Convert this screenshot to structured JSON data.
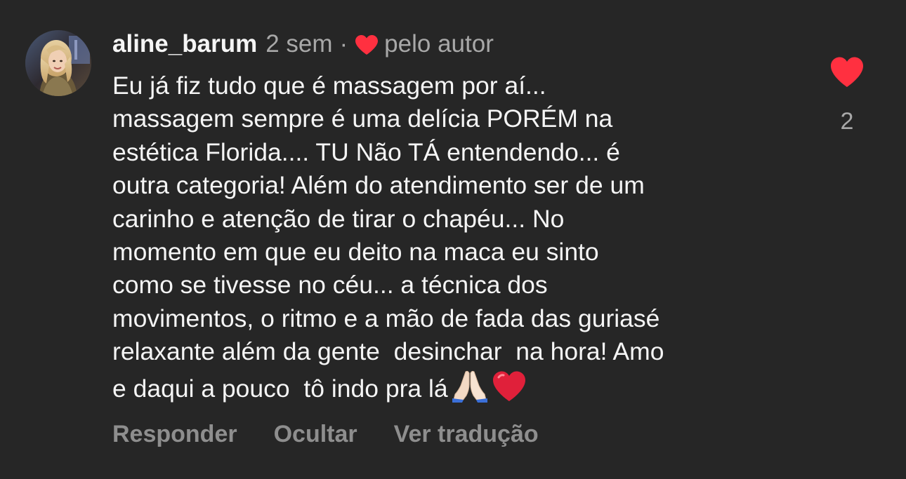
{
  "comment": {
    "username": "aline_barum",
    "time": "2 sem",
    "separator": "·",
    "liked_by_author_label": "pelo autor",
    "text_lines": [
      "Eu já fiz tudo que é massagem por aí...",
      "massagem sempre é uma delícia PORÉM na",
      "estética Florida.... TU Não TÁ entendendo... é",
      "outra categoria! Além do atendimento ser de um",
      "carinho e atenção de tirar o chapéu... No",
      "momento em que eu deito na maca eu sinto",
      "como se tivesse no céu... a técnica dos",
      "movimentos, o ritmo e a mão de fada das guriasé",
      "relaxante além da gente  desinchar  na hora! Amo",
      "e daqui a pouco  tô indo pra lá"
    ],
    "emoji_icons": [
      "folded-hands-icon",
      "red-heart-icon"
    ],
    "like_count": "2",
    "actions": {
      "reply": "Responder",
      "hide": "Ocultar",
      "translate": "Ver tradução"
    }
  },
  "colors": {
    "background": "#262626",
    "text": "#f5f5f5",
    "secondary": "#a8a8a8",
    "action": "#8e8e8e",
    "heart": "#ff3040"
  }
}
